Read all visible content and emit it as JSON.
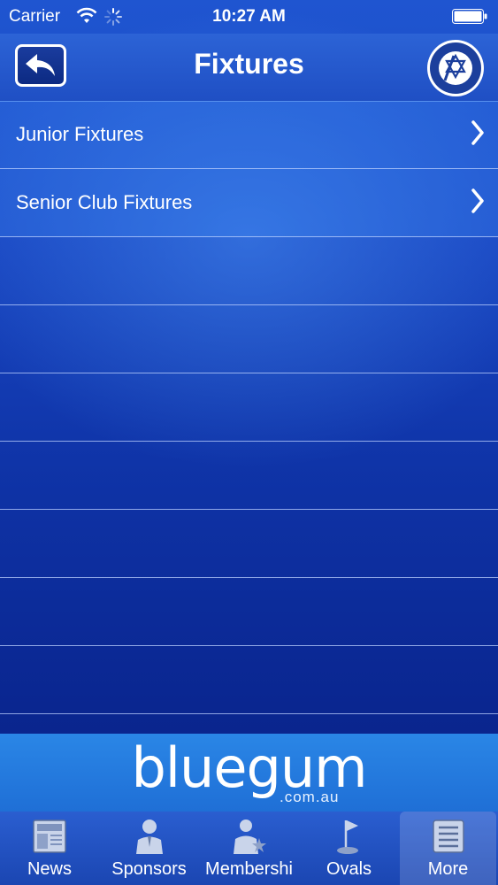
{
  "status_bar": {
    "carrier": "Carrier",
    "time": "10:27 AM"
  },
  "nav_bar": {
    "title": "Fixtures",
    "back_icon": "back-arrow-icon",
    "logo_icon": "club-logo-icon"
  },
  "list": {
    "items": [
      {
        "label": "Junior Fixtures"
      },
      {
        "label": "Senior Club Fixtures"
      }
    ]
  },
  "banner": {
    "brand": "bluegum",
    "domain": ".com.au"
  },
  "tab_bar": {
    "tabs": [
      {
        "label": "News",
        "icon": "newspaper-icon"
      },
      {
        "label": "Sponsors",
        "icon": "person-icon"
      },
      {
        "label": "Membershi",
        "icon": "member-icon"
      },
      {
        "label": "Ovals",
        "icon": "flag-icon"
      },
      {
        "label": "More",
        "icon": "list-icon"
      }
    ],
    "active": "More"
  },
  "colors": {
    "background_top": "#1f55d0",
    "background_bottom": "#071f80",
    "banner": "#2a86e6",
    "separator": "#bed2ff"
  }
}
